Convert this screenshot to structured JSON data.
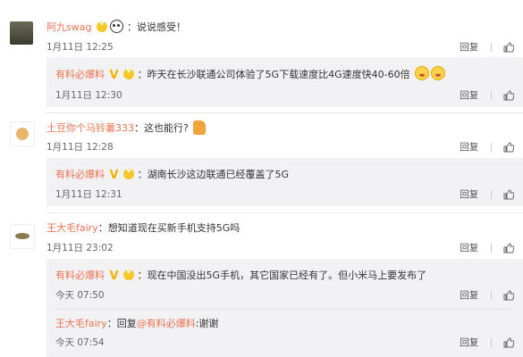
{
  "comments": [
    {
      "user": "阿九swag",
      "colon": "：",
      "text": "说说感受！",
      "time": "1月11日 12:25",
      "reply": "回复",
      "replies": [
        {
          "user": "有料必爆料",
          "colon": "：",
          "text": "昨天在长沙联通公司体验了5G下载速度比4G速度快40-60倍",
          "time": "1月11日 12:30",
          "reply": "回复"
        }
      ]
    },
    {
      "user": "土豆你个马铃薯333",
      "colon": "：",
      "text": "这也能行?",
      "time": "1月11日 12:28",
      "reply": "回复",
      "replies": [
        {
          "user": "有料必爆料",
          "colon": "：",
          "text": "湖南长沙这边联通已经覆盖了5G",
          "time": "1月11日 12:31",
          "reply": "回复"
        }
      ]
    },
    {
      "user": "王大毛fairy",
      "colon": "：",
      "text": "想知道现在买新手机支持5G吗",
      "time": "1月11日 23:02",
      "reply": "回复",
      "replies": [
        {
          "user": "有料必爆料",
          "colon": "：",
          "text": "现在中国没出5G手机，其它国家已经有了。但小米马上要发布了",
          "time": "今天 07:50",
          "reply": "回复"
        },
        {
          "user": "王大毛fairy",
          "colon": "：",
          "text_prefix": "回复",
          "mention": "@有料必爆料",
          "text": ":谢谢",
          "time": "今天 07:54",
          "reply": "回复"
        }
      ]
    }
  ],
  "colors": {
    "username": "#eb7350",
    "reply_bg": "#f2f2f5"
  },
  "icons": [
    "panda-emoji-icon",
    "laughing-emoji-icon",
    "thumbs-up-emoji-icon",
    "like-icon",
    "verified-badge-icon"
  ]
}
